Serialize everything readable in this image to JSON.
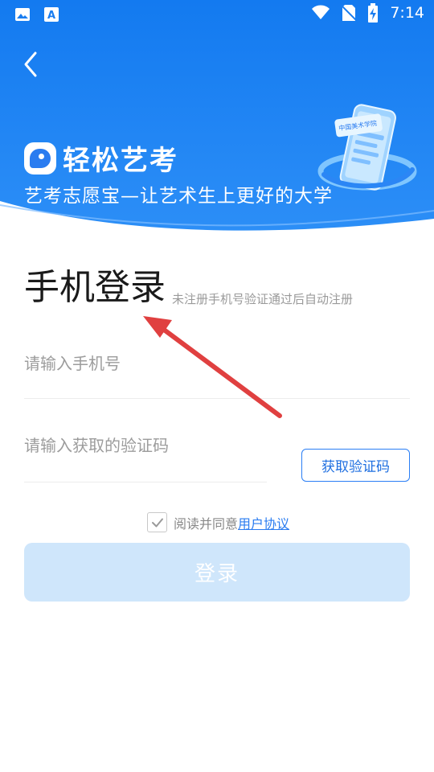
{
  "status_bar": {
    "time": "7:14"
  },
  "brand": {
    "name": "轻松艺考",
    "slogan": "艺考志愿宝—让艺术生上更好的大学"
  },
  "illustration": {
    "label": "中国美术学院"
  },
  "login": {
    "title": "手机登录",
    "subtitle": "未注册手机号验证通过后自动注册",
    "phone_placeholder": "请输入手机号",
    "code_placeholder": "请输入获取的验证码",
    "get_code_label": "获取验证码",
    "agree_prefix": "阅读并同意",
    "agreement_link": "用户协议",
    "submit_label": "登录",
    "agreed": true
  },
  "colors": {
    "brand_blue": "#1f7ff2",
    "button_disabled": "#cfe6fb",
    "annotation_red": "#e04040"
  }
}
